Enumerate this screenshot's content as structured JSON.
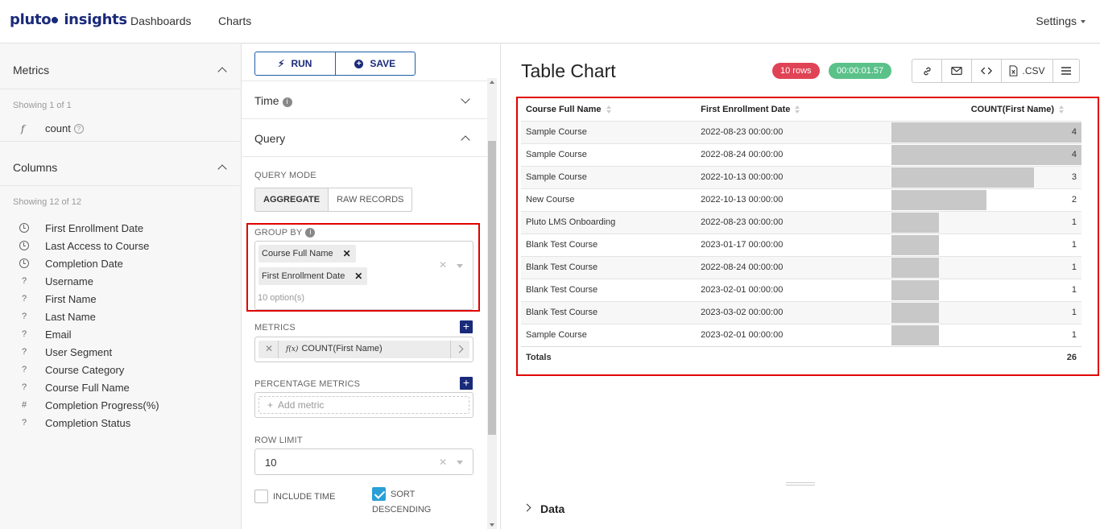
{
  "nav": {
    "logo_left": "pluto",
    "logo_right": "insights",
    "links": [
      "Dashboards",
      "Charts"
    ],
    "settings": "Settings"
  },
  "datasource": {
    "metrics_title": "Metrics",
    "metrics_showing": "Showing 1 of 1",
    "metric": {
      "icon": "f",
      "name": "count"
    },
    "columns_title": "Columns",
    "columns_showing": "Showing 12 of 12",
    "columns": [
      {
        "type": "time",
        "name": "First Enrollment Date"
      },
      {
        "type": "time",
        "name": "Last Access to Course"
      },
      {
        "type": "time",
        "name": "Completion Date"
      },
      {
        "type": "?",
        "name": "Username"
      },
      {
        "type": "?",
        "name": "First Name"
      },
      {
        "type": "?",
        "name": "Last Name"
      },
      {
        "type": "?",
        "name": "Email"
      },
      {
        "type": "?",
        "name": "User Segment"
      },
      {
        "type": "?",
        "name": "Course Category"
      },
      {
        "type": "?",
        "name": "Course Full Name"
      },
      {
        "type": "#",
        "name": "Completion Progress(%)"
      },
      {
        "type": "?",
        "name": "Completion Status"
      }
    ]
  },
  "controls": {
    "run_label": "RUN",
    "save_label": "SAVE",
    "time_title": "Time",
    "query_title": "Query",
    "query_mode_label": "QUERY MODE",
    "mode_aggregate": "AGGREGATE",
    "mode_raw": "RAW RECORDS",
    "group_by_label": "GROUP BY",
    "group_by_tags": [
      "Course Full Name",
      "First Enrollment Date"
    ],
    "group_by_hint": "10 option(s)",
    "metrics_label": "METRICS",
    "metric_value": "COUNT(First Name)",
    "metric_fx": "f(x)",
    "pct_metrics_label": "PERCENTAGE METRICS",
    "add_metric_placeholder": "Add metric",
    "row_limit_label": "ROW LIMIT",
    "row_limit_value": "10",
    "include_time_label": "INCLUDE TIME",
    "include_time_checked": false,
    "sort_desc_label_1": "SORT",
    "sort_desc_label_2": "DESCENDING",
    "sort_desc_checked": true
  },
  "chart": {
    "title": "Table Chart",
    "rows_badge": "10 rows",
    "time_badge": "00:00:01.57",
    "rows_badge_color": "#e04355",
    "time_badge_color": "#5ac189",
    "csv_label": ".CSV",
    "data_section": "Data"
  },
  "chart_data": {
    "type": "table",
    "columns": [
      "Course Full Name",
      "First Enrollment Date",
      "COUNT(First Name)"
    ],
    "rows": [
      [
        "Sample Course",
        "2022-08-23 00:00:00",
        4
      ],
      [
        "Sample Course",
        "2022-08-24 00:00:00",
        4
      ],
      [
        "Sample Course",
        "2022-10-13 00:00:00",
        3
      ],
      [
        "New Course",
        "2022-10-13 00:00:00",
        2
      ],
      [
        "Pluto LMS Onboarding",
        "2022-08-23 00:00:00",
        1
      ],
      [
        "Blank Test Course",
        "2023-01-17 00:00:00",
        1
      ],
      [
        "Blank Test Course",
        "2022-08-24 00:00:00",
        1
      ],
      [
        "Blank Test Course",
        "2023-02-01 00:00:00",
        1
      ],
      [
        "Blank Test Course",
        "2023-03-02 00:00:00",
        1
      ],
      [
        "Sample Course",
        "2023-02-01 00:00:00",
        1
      ]
    ],
    "totals_label": "Totals",
    "totals_value": 26,
    "max_value": 4
  }
}
